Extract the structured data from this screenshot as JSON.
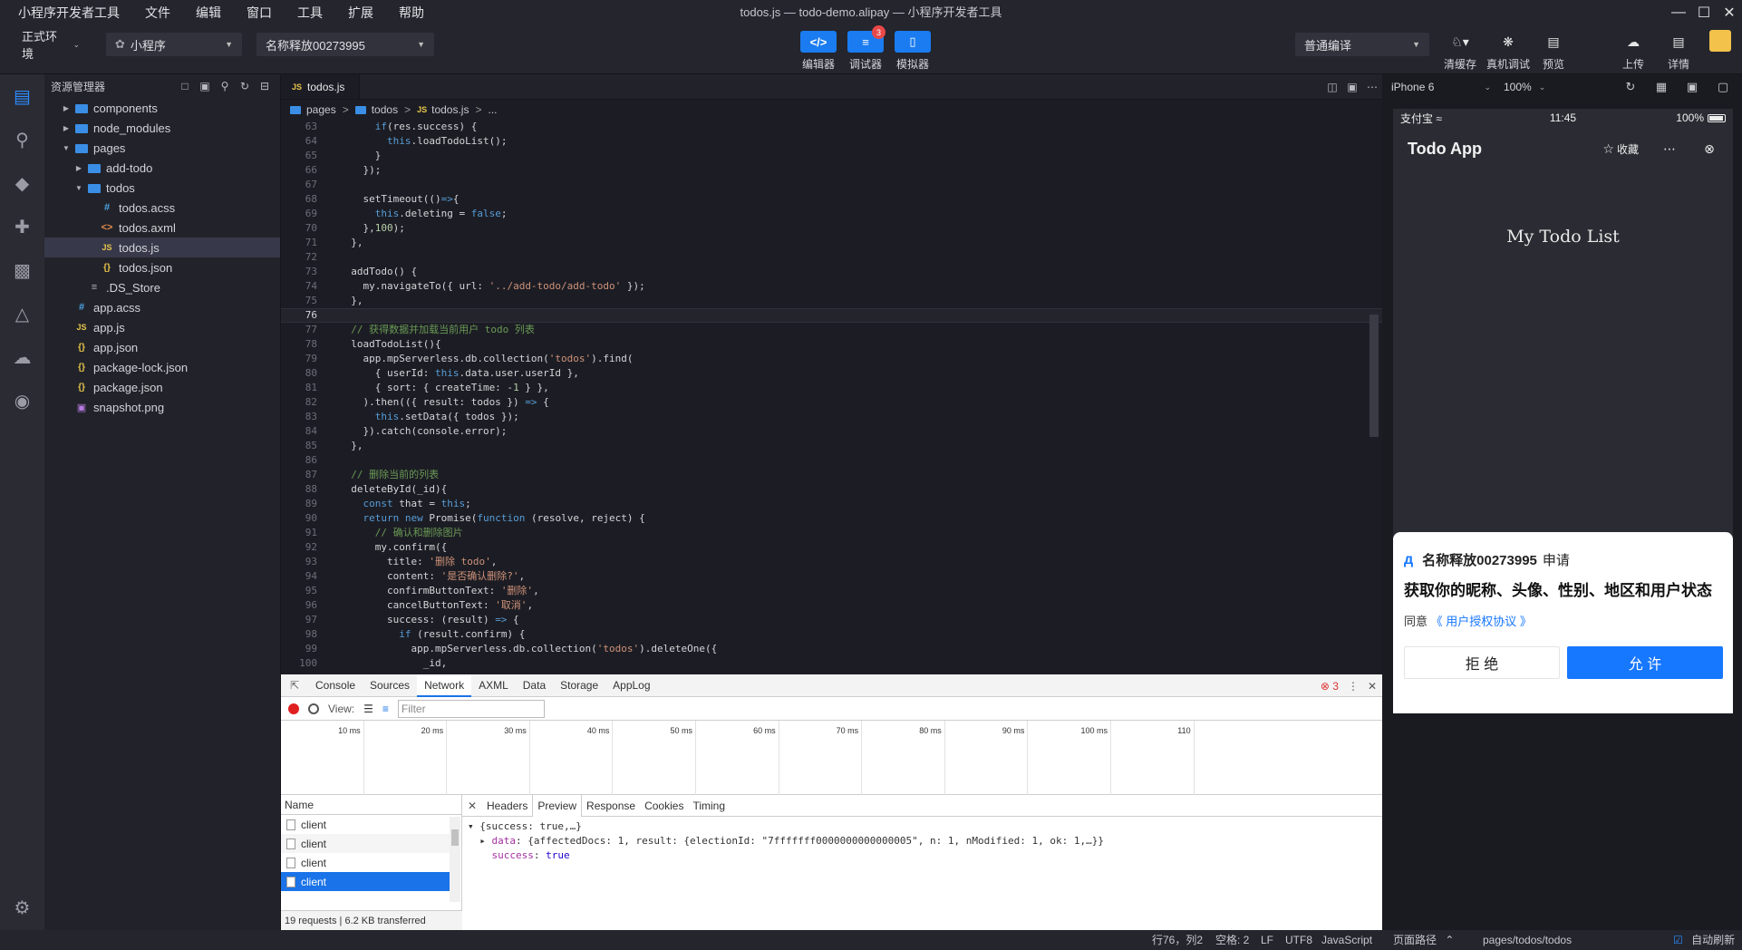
{
  "menu": {
    "items": [
      "小程序开发者工具",
      "文件",
      "编辑",
      "窗口",
      "工具",
      "扩展",
      "帮助"
    ],
    "window_title": "todos.js — todo-demo.alipay — 小程序开发者工具"
  },
  "toolbar": {
    "env_label": "正式环境",
    "type_label": "小程序",
    "app_name": "名称释放00273995",
    "modes": [
      {
        "label": "编辑器",
        "icon": "</>"
      },
      {
        "label": "调试器",
        "icon": "≡",
        "badge": "3"
      },
      {
        "label": "模拟器",
        "icon": "▯"
      }
    ],
    "compile_mode": "普通编译",
    "actions": [
      {
        "label": "清缓存",
        "icon": "broom-icon"
      },
      {
        "label": "真机调试",
        "icon": "bug-icon"
      },
      {
        "label": "预览",
        "icon": "preview-icon"
      },
      {
        "label": "上传",
        "icon": "upload-icon"
      },
      {
        "label": "详情",
        "icon": "details-icon"
      }
    ]
  },
  "explorer": {
    "title": "资源管理器",
    "tree": [
      {
        "name": "components",
        "type": "folder",
        "depth": 0,
        "expanded": false
      },
      {
        "name": "node_modules",
        "type": "folder",
        "depth": 0,
        "expanded": false
      },
      {
        "name": "pages",
        "type": "folder",
        "depth": 0,
        "expanded": true
      },
      {
        "name": "add-todo",
        "type": "folder",
        "depth": 1,
        "expanded": false
      },
      {
        "name": "todos",
        "type": "folder",
        "depth": 1,
        "expanded": true
      },
      {
        "name": "todos.acss",
        "type": "css",
        "depth": 2
      },
      {
        "name": "todos.axml",
        "type": "xml",
        "depth": 2
      },
      {
        "name": "todos.js",
        "type": "js",
        "depth": 2,
        "selected": true
      },
      {
        "name": "todos.json",
        "type": "json",
        "depth": 2
      },
      {
        "name": ".DS_Store",
        "type": "txt",
        "depth": 1
      },
      {
        "name": "app.acss",
        "type": "css",
        "depth": 0
      },
      {
        "name": "app.js",
        "type": "js",
        "depth": 0
      },
      {
        "name": "app.json",
        "type": "json",
        "depth": 0
      },
      {
        "name": "package-lock.json",
        "type": "json",
        "depth": 0
      },
      {
        "name": "package.json",
        "type": "json",
        "depth": 0
      },
      {
        "name": "snapshot.png",
        "type": "png",
        "depth": 0
      }
    ]
  },
  "editor": {
    "tab_label": "todos.js",
    "breadcrumb": [
      "pages",
      "todos",
      "todos.js",
      "..."
    ],
    "current_line": 76,
    "lines": [
      {
        "n": "63",
        "text": "      if(res.success) {"
      },
      {
        "n": "64",
        "text": "        this.loadTodoList();"
      },
      {
        "n": "65",
        "text": "      }"
      },
      {
        "n": "66",
        "text": "    });"
      },
      {
        "n": "67",
        "text": ""
      },
      {
        "n": "68",
        "text": "    setTimeout(()=>{"
      },
      {
        "n": "69",
        "text": "      this.deleting = false;"
      },
      {
        "n": "70",
        "text": "    },100);"
      },
      {
        "n": "71",
        "text": "  },"
      },
      {
        "n": "72",
        "text": ""
      },
      {
        "n": "73",
        "text": "  addTodo() {"
      },
      {
        "n": "74",
        "text": "    my.navigateTo({ url: '../add-todo/add-todo' });"
      },
      {
        "n": "75",
        "text": "  },"
      },
      {
        "n": "76",
        "text": ""
      },
      {
        "n": "77",
        "text": "  // 获得数据并加载当前用户 todo 列表"
      },
      {
        "n": "78",
        "text": "  loadTodoList(){"
      },
      {
        "n": "79",
        "text": "    app.mpServerless.db.collection('todos').find("
      },
      {
        "n": "80",
        "text": "      { userId: this.data.user.userId },"
      },
      {
        "n": "81",
        "text": "      { sort: { createTime: -1 } },"
      },
      {
        "n": "82",
        "text": "    ).then(({ result: todos }) => {"
      },
      {
        "n": "83",
        "text": "      this.setData({ todos });"
      },
      {
        "n": "84",
        "text": "    }).catch(console.error);"
      },
      {
        "n": "85",
        "text": "  },"
      },
      {
        "n": "86",
        "text": ""
      },
      {
        "n": "87",
        "text": "  // 删除当前的列表"
      },
      {
        "n": "88",
        "text": "  deleteById(_id){"
      },
      {
        "n": "89",
        "text": "    const that = this;"
      },
      {
        "n": "90",
        "text": "    return new Promise(function (resolve, reject) {"
      },
      {
        "n": "91",
        "text": "      // 确认和删除图片"
      },
      {
        "n": "92",
        "text": "      my.confirm({"
      },
      {
        "n": "93",
        "text": "        title: '删除 todo',"
      },
      {
        "n": "94",
        "text": "        content: '是否确认删除?',"
      },
      {
        "n": "95",
        "text": "        confirmButtonText: '删除',"
      },
      {
        "n": "96",
        "text": "        cancelButtonText: '取消',"
      },
      {
        "n": "97",
        "text": "        success: (result) => {"
      },
      {
        "n": "98",
        "text": "          if (result.confirm) {"
      },
      {
        "n": "99",
        "text": "            app.mpServerless.db.collection('todos').deleteOne({"
      },
      {
        "n": "100",
        "text": "              _id,"
      }
    ]
  },
  "devtools": {
    "tabs": [
      "Console",
      "Sources",
      "Network",
      "AXML",
      "Data",
      "Storage",
      "AppLog"
    ],
    "active_tab": "Network",
    "error_count": "3",
    "view_label": "View:",
    "filter_placeholder": "Filter",
    "timeline_ticks": [
      "10 ms",
      "20 ms",
      "30 ms",
      "40 ms",
      "50 ms",
      "60 ms",
      "70 ms",
      "80 ms",
      "90 ms",
      "100 ms",
      "110"
    ],
    "name_header": "Name",
    "requests": [
      "client",
      "client",
      "client",
      "client"
    ],
    "selected_request": 3,
    "status_text": "19 requests  |  6.2 KB transferred",
    "detail_tabs": [
      "Headers",
      "Preview",
      "Response",
      "Cookies",
      "Timing"
    ],
    "active_detail_tab": "Preview",
    "preview": {
      "root": "{success: true,…}",
      "data_key": "data",
      "data_value": "{affectedDocs: 1, result: {electionId: \"7fffffff0000000000000005\", n: 1, nModified: 1, ok: 1,…}}",
      "success_key": "success",
      "success_value": "true"
    }
  },
  "simulator": {
    "device": "iPhone 6",
    "zoom": "100%",
    "status": {
      "carrier": "支付宝",
      "time": "11:45",
      "battery": "100%"
    },
    "app_title": "Todo App",
    "fav_label": "收藏",
    "heading": "My Todo List",
    "auth": {
      "app_name": "名称释放00273995",
      "request_word": "申请",
      "scope": "获取你的昵称、头像、性别、地区和用户状态",
      "agree_prefix": "同意",
      "agree_link": "《 用户授权协议 》",
      "reject_label": "拒 绝",
      "allow_label": "允 许"
    }
  },
  "statusbar": {
    "cursor": "行76，列2",
    "indent": "空格: 2",
    "eol": "LF",
    "encoding": "UTF8",
    "language": "JavaScript",
    "page_path_label": "页面路径",
    "page_path": "pages/todos/todos",
    "auto_refresh": "自动刷新"
  }
}
